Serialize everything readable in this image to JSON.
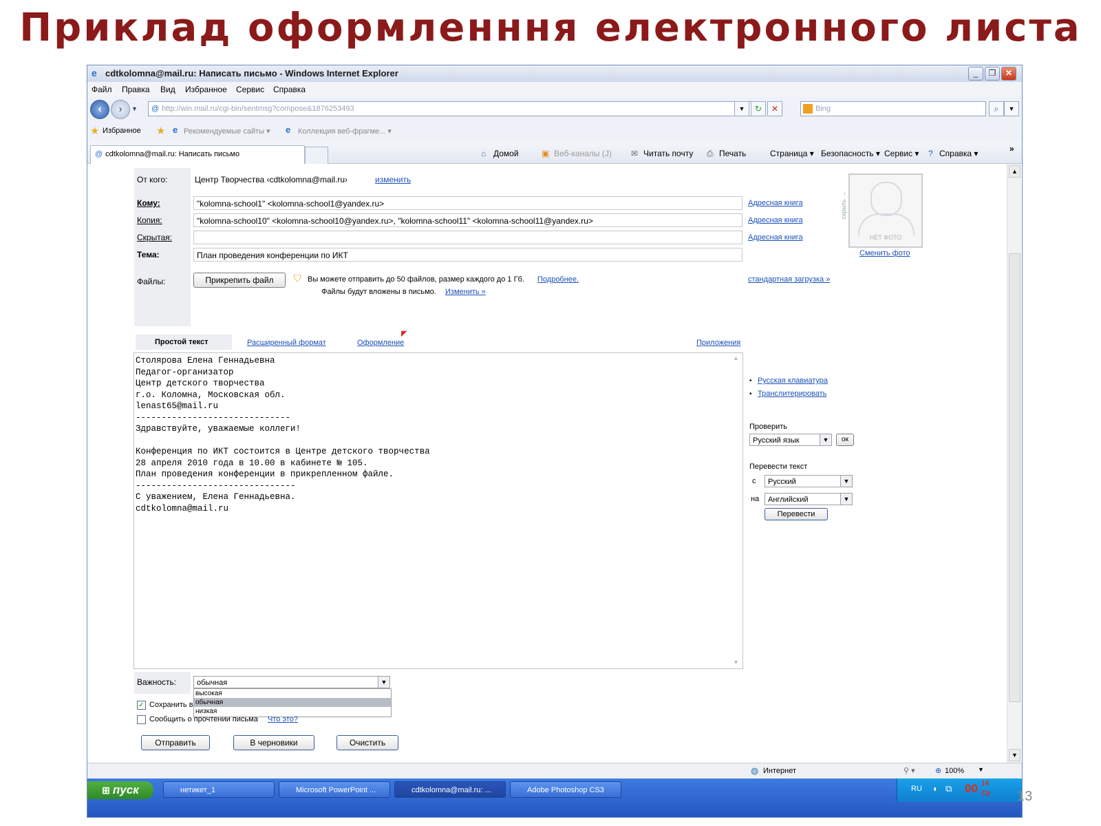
{
  "slide": {
    "title": "Приклад оформленння електронного листа",
    "page_number": "13"
  },
  "window": {
    "title": "cdtkolomna@mail.ru: Написать письмо - Windows Internet Explorer",
    "controls": {
      "minimize": "_",
      "restore": "❐",
      "close": "✕"
    }
  },
  "menu": [
    "Файл",
    "Правка",
    "Вид",
    "Избранное",
    "Сервис",
    "Справка"
  ],
  "address": {
    "url": "http://win.mail.ru/cgi-bin/sentmsg?compose&1876253493",
    "search_placeholder": "Bing"
  },
  "favorites": {
    "label": "Избранное",
    "items": [
      "Рекомендуемые сайты ▾",
      "Коллекция веб-фрагме... ▾"
    ]
  },
  "tab": {
    "label": "cdtkolomna@mail.ru: Написать письмо"
  },
  "commands": [
    "Домой",
    "Веб-каналы (J)",
    "Читать почту",
    "Печать",
    "Страница ▾",
    "Безопасность ▾",
    "Сервис ▾",
    "Справка ▾"
  ],
  "compose": {
    "from_label": "От кого:",
    "from_value": "Центр Творчества ‹cdtkolomna@mail.ru›",
    "change_link": "изменить",
    "to_label": "Кому:",
    "to_value": "\"kolomna-school1\" <kolomna-school1@yandex.ru>",
    "cc_label": "Копия:",
    "cc_value": "\"kolomna-school10\" <kolomna-school10@yandex.ru>, \"kolomna-school11\" <kolomna-school11@yandex.ru>",
    "bcc_label": "Скрытая:",
    "bcc_value": "",
    "subject_label": "Тема:",
    "subject_value": "План проведения конференции по ИКТ",
    "address_book": "Адресная книга",
    "hide_label": "скрыть →",
    "photo_caption": "НЕТ ФОТО",
    "change_photo": "Сменить фото",
    "files_label": "Файлы:",
    "attach_button": "Прикрепить файл",
    "files_hint": "Вы можете отправить до 50 файлов, размер каждого до 1 Гб.",
    "files_more": "Подробнее.",
    "files_hint2": "Файлы будут вложены в письмо.",
    "files_change": "Изменить »",
    "standard_upload": "стандартная загрузка »",
    "tabs": [
      "Простой текст",
      "Расширенный формат",
      "Оформление"
    ],
    "attachments_link": "Приложения",
    "body_lines": [
      "Столярова Елена Геннадьевна",
      "Педагог-организатор",
      "Центр детского творчества",
      "г.о. Коломна, Московская обл.",
      "lenast65@mail.ru",
      "------------------------------",
      "Здравствуйте, уважаемые коллеги!",
      "",
      "Конференция по ИКТ состоится в Центре детского творчества",
      "28 апреля 2010 года в 10.00 в кабинете № 105.",
      "План проведения конференции в прикрепленном файле.",
      "-------------------------------",
      "С уважением, Елена Геннадьевна.",
      "cdtkolomna@mail.ru"
    ],
    "side_links": [
      "Русская клавиатура",
      "Транслитерировать"
    ],
    "check_label": "Проверить",
    "check_lang": "Русский язык",
    "ok_button": "ок",
    "translate_label": "Перевести текст",
    "from_lang_prefix": "с",
    "from_lang": "Русский",
    "to_lang_prefix": "на",
    "to_lang": "Английский",
    "translate_button": "Перевести",
    "importance_label": "Важность:",
    "importance_value": "обычная",
    "importance_options": [
      "высокая",
      "обычная",
      "низкая"
    ],
    "save_label": "Сохранить в",
    "notify_label": "Сообщить о прочтении письма",
    "what_link": "Что это?",
    "send_button": "Отправить",
    "draft_button": "В черновики",
    "clear_button": "Очистить"
  },
  "status": {
    "zone": "Интернет",
    "zoom": "100%"
  },
  "taskbar": {
    "start": "пуск",
    "tasks": [
      "нетикет_1",
      "Microsoft PowerPoint ...",
      "cdtkolomna@mail.ru: ...",
      "Adobe Photoshop CS3"
    ],
    "lang": "RU",
    "clock": "00",
    "clock_small": "14",
    "day": "Ср"
  },
  "colors": {
    "title_red": "#8b1a1a",
    "link_blue": "#1a50b8",
    "taskbar_blue": "#2456c0"
  }
}
